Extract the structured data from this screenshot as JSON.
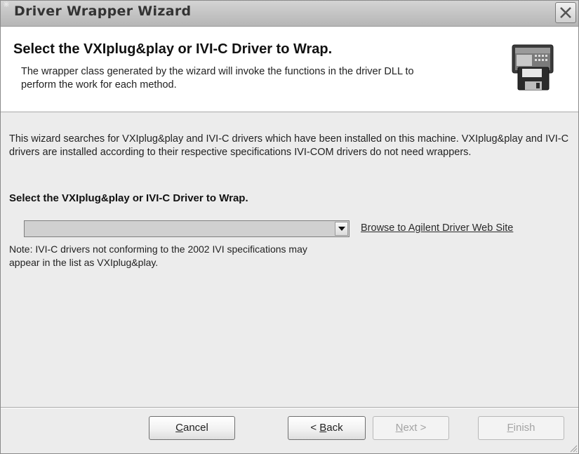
{
  "window": {
    "title": "Driver Wrapper Wizard",
    "close_icon": "close-icon"
  },
  "header": {
    "title": "Select the VXIplug&play or IVI-C Driver to Wrap.",
    "subtitle": "The wrapper class generated by the wizard will invoke the functions in the driver DLL to perform the work for each method.",
    "icon": "driver-disk-icon"
  },
  "body": {
    "intro": "This wizard searches for VXIplug&play and IVI-C drivers which have been installed on this machine.  VXIplug&play and IVI-C drivers are installed according to their respective specifications  IVI-COM drivers do not need wrappers.",
    "section_label": "Select the VXIplug&play or IVI-C Driver to Wrap.",
    "driver_select": {
      "value": "",
      "dropdown_icon": "chevron-down-icon"
    },
    "browse_link": "Browse to Agilent Driver Web Site",
    "note": "Note:  IVI-C drivers not conforming to the 2002 IVI specifications may appear in the list as VXIplug&play."
  },
  "footer": {
    "cancel_label": "Cancel",
    "cancel_accel": "C",
    "cancel_rest": "ancel",
    "back_prefix": "< ",
    "back_accel": "B",
    "back_rest": "ack",
    "next_accel": "N",
    "next_rest": "ext >",
    "finish_accel": "F",
    "finish_rest": "inish",
    "next_enabled": false,
    "finish_enabled": false
  }
}
